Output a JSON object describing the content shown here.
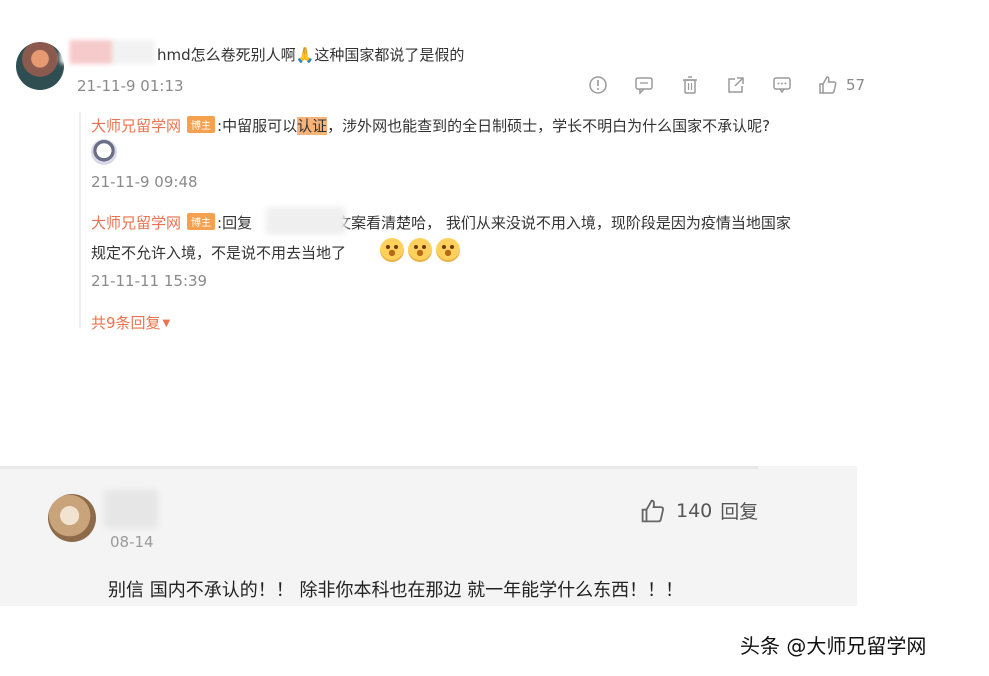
{
  "comment1": {
    "text": "hmd怎么卷死别人啊🙏这种国家都说了是假的",
    "time": "21-11-9 01:13",
    "like_count": "57",
    "icons": [
      "info-icon",
      "message-icon",
      "trash-icon",
      "share-icon",
      "comment-icon",
      "thumbs-up-icon"
    ]
  },
  "replies": [
    {
      "username": "大师兄留学网",
      "badge": "博主",
      "pre": ":中留服可以",
      "highlight": "认证",
      "post": "，涉外网也能查到的全日制硕士，学长不明白为什么国家不承认呢?",
      "time": "21-11-9 09:48"
    },
    {
      "username": "大师兄留学网",
      "badge": "博主",
      "pre": ":回复",
      "post": "文案看清楚哈， 我们从来没说不用入境，现阶段是因为疫情当地国家",
      "line2": "规定不允许入境，不是说不用去当地了",
      "time": "21-11-11 15:39"
    }
  ],
  "more_replies": "共9条回复",
  "comment2": {
    "date": "08-14",
    "likes": "140",
    "reply_label": "回复",
    "text": "别信 国内不承认的！！ 除非你本科也在那边 就一年能学什么东西！！！"
  },
  "watermark": "头条 @大师兄留学网",
  "colors": {
    "username": "#eb7350",
    "badge": "#f6a14f",
    "highlight": "#f7b37a"
  }
}
